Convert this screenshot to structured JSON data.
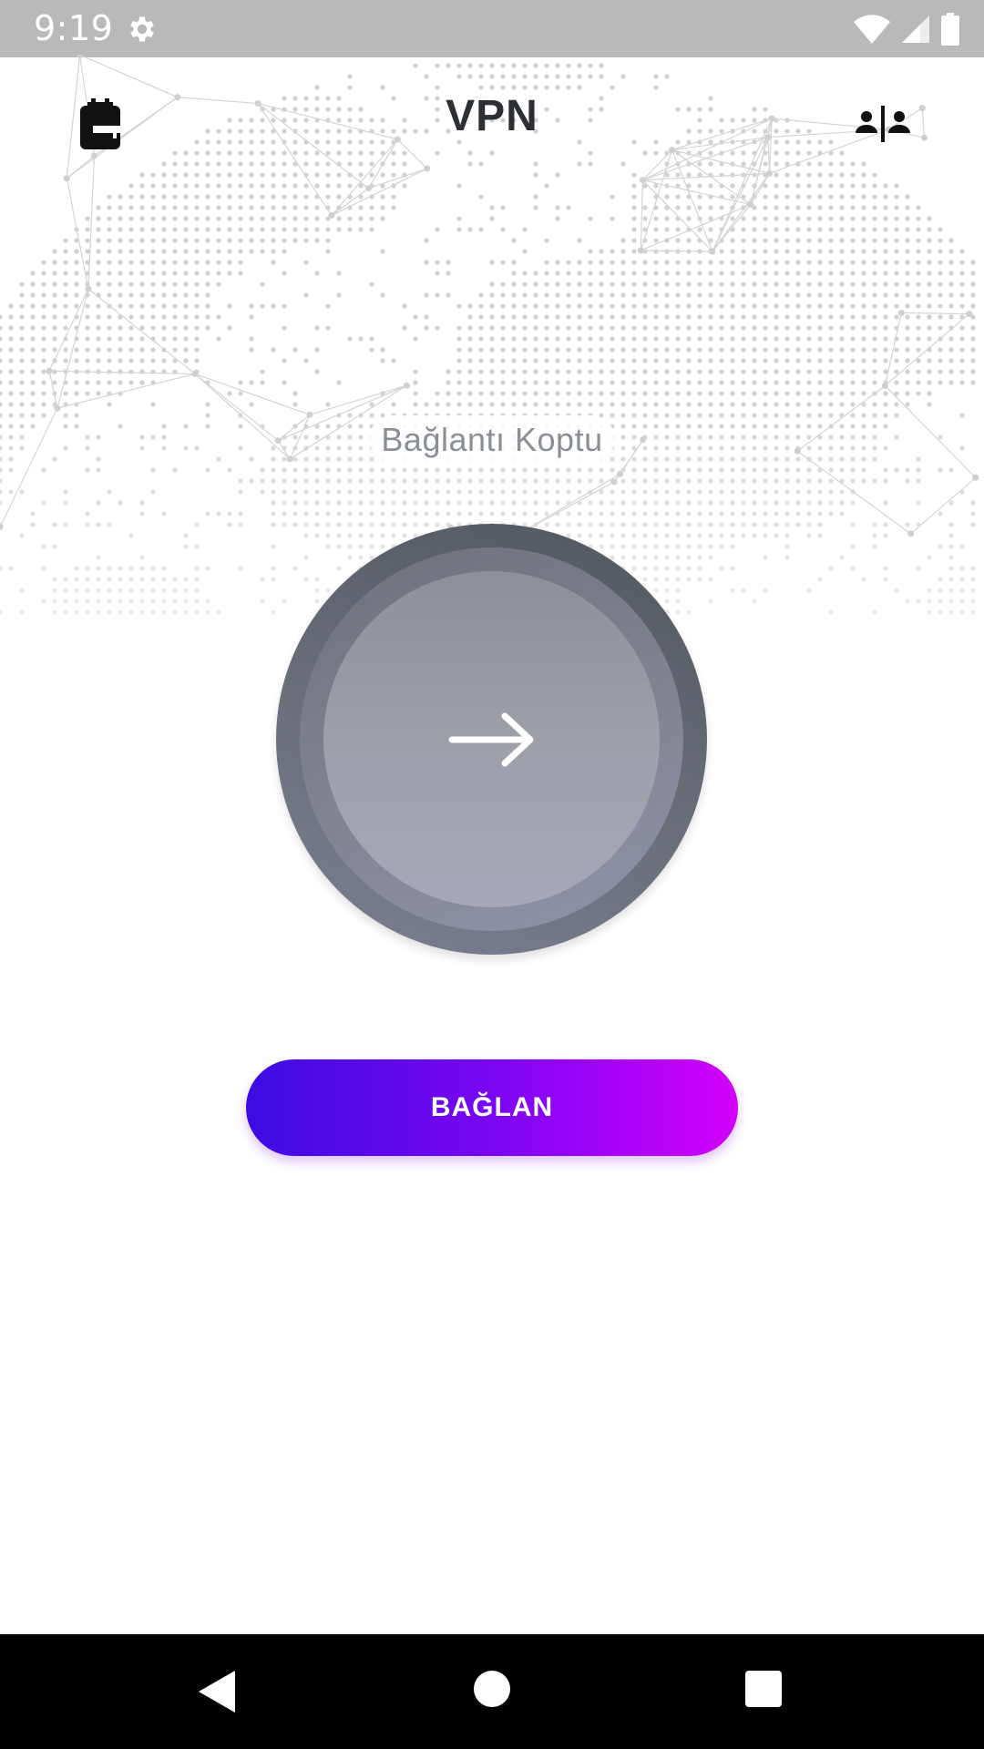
{
  "status_bar": {
    "time": "9:19",
    "settings_icon": "gear-icon",
    "wifi_icon": "wifi-icon",
    "signal_icon": "signal-icon",
    "battery_icon": "battery-icon"
  },
  "header": {
    "title": "VPN",
    "left_icon": "backpack-icon",
    "right_icon": "people-split-icon"
  },
  "connection": {
    "status_text": "Bağlantı Koptu",
    "power_icon": "arrow-right-icon",
    "connect_label": "BAĞLAN"
  },
  "colors": {
    "status_bar_bg": "#b9b9b9",
    "connect_gradient_start": "#3a0ce0",
    "connect_gradient_end": "#d300fb",
    "title_color": "#2c2f33",
    "status_text_color": "#8a8f95"
  },
  "nav_bar": {
    "back_icon": "back-triangle-icon",
    "home_icon": "home-circle-icon",
    "recents_icon": "recents-square-icon"
  }
}
